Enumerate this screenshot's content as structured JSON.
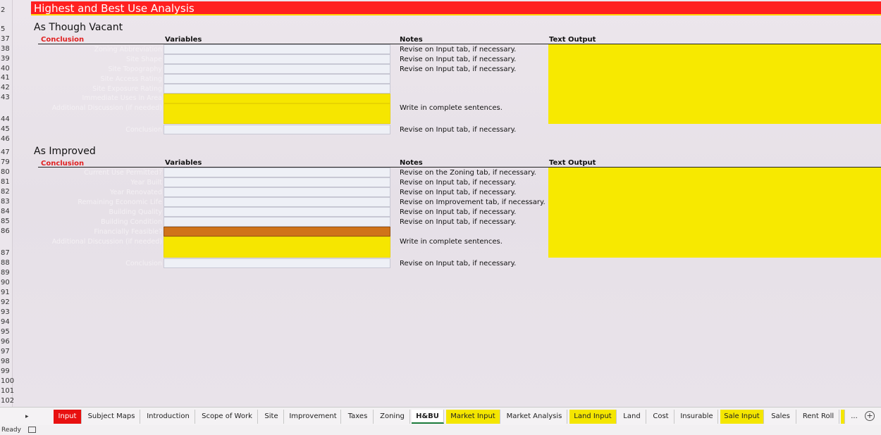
{
  "title": "Highest and Best Use Analysis",
  "row_numbers": [
    "2",
    "5",
    "37",
    "38",
    "39",
    "40",
    "41",
    "42",
    "43",
    "44",
    "45",
    "46",
    "47",
    "79",
    "80",
    "81",
    "82",
    "83",
    "84",
    "85",
    "86",
    "87",
    "88",
    "89",
    "90",
    "91",
    "92",
    "93",
    "94",
    "95",
    "96",
    "97",
    "98",
    "99",
    "100",
    "101",
    "102"
  ],
  "vacant": {
    "title": "As Though Vacant",
    "conclusion": "Conclusion",
    "variables_header": "Variables",
    "notes_header": "Notes",
    "output_header": "Text Output",
    "rows": [
      {
        "label": "Zoning Abbreviation",
        "note": "Revise on Input tab, if necessary."
      },
      {
        "label": "Site Shape",
        "note": "Revise on Input tab, if necessary."
      },
      {
        "label": "Site Topography",
        "note": "Revise on Input tab, if necessary."
      },
      {
        "label": "Site Access Rating",
        "note": ""
      },
      {
        "label": "Site Exposure Rating",
        "note": ""
      },
      {
        "label": "Immediate Uses in Area",
        "note": ""
      },
      {
        "label": "Additional Discussion (if needed)",
        "note": "Write in complete sentences."
      },
      {
        "label": "Conclusion",
        "note": "Revise on Input tab, if necessary."
      }
    ]
  },
  "improved": {
    "title": "As Improved",
    "conclusion": "Conclusion",
    "variables_header": "Variables",
    "notes_header": "Notes",
    "output_header": "Text Output",
    "rows": [
      {
        "label": "Current Use Permitted?",
        "note": "Revise on the Zoning tab, if necessary."
      },
      {
        "label": "Year Built",
        "note": "Revise on Input tab, if necessary."
      },
      {
        "label": "Year Renovated",
        "note": "Revise on Input tab, if necessary."
      },
      {
        "label": "Remaining Economic Life",
        "note": "Revise on Improvement tab, if necessary."
      },
      {
        "label": "Building Quality",
        "note": "Revise on Input tab, if necessary."
      },
      {
        "label": "Building Condition",
        "note": "Revise on Input tab, if necessary."
      },
      {
        "label": "Financially Feasible?",
        "note": ""
      },
      {
        "label": "Additional Discussion (if needed)",
        "note": "Write in complete sentences."
      },
      {
        "label": "Conclusion",
        "note": "Revise on Input tab, if necessary."
      }
    ]
  },
  "tabs": [
    {
      "label": "Input",
      "style": "red"
    },
    {
      "label": "Subject Maps",
      "style": "normal"
    },
    {
      "label": "Introduction",
      "style": "normal"
    },
    {
      "label": "Scope of Work",
      "style": "normal"
    },
    {
      "label": "Site",
      "style": "normal"
    },
    {
      "label": "Improvement",
      "style": "normal"
    },
    {
      "label": "Taxes",
      "style": "normal"
    },
    {
      "label": "Zoning",
      "style": "normal"
    },
    {
      "label": "H&BU",
      "style": "active"
    },
    {
      "label": "Market Input",
      "style": "yellow"
    },
    {
      "label": "Market Analysis",
      "style": "normal"
    },
    {
      "label": "Land Input",
      "style": "yellow"
    },
    {
      "label": "Land",
      "style": "normal"
    },
    {
      "label": "Cost",
      "style": "normal"
    },
    {
      "label": "Insurable",
      "style": "normal"
    },
    {
      "label": "Sale Input",
      "style": "yellow"
    },
    {
      "label": "Sales",
      "style": "normal"
    },
    {
      "label": "Rent Roll",
      "style": "normal"
    }
  ],
  "tab_more": "...",
  "tab_add": "+",
  "tab_nav": "▸",
  "status": "Ready",
  "colors": {
    "title_bar": "#ff2020",
    "input_yellow": "#f6e600",
    "orange_cell": "#d0741a",
    "output_yellow": "#f7e900"
  }
}
